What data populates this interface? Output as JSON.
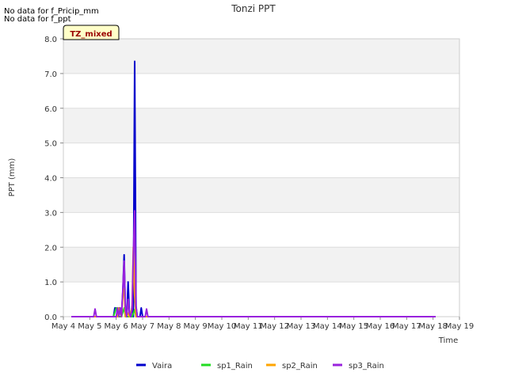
{
  "notices": [
    "No data for f_Pricip_mm",
    "No data for f_ppt"
  ],
  "chart_data": {
    "type": "line",
    "title": "Tonzi PPT",
    "xlabel": "Time",
    "ylabel": "PPT (mm)",
    "badge": "TZ_mixed",
    "ylim": [
      0,
      8
    ],
    "xlim": [
      4,
      19
    ],
    "y_ticks": [
      "0.0",
      "1.0",
      "2.0",
      "3.0",
      "4.0",
      "5.0",
      "6.0",
      "7.0",
      "8.0"
    ],
    "x_ticks": [
      "May 4",
      "May 5",
      "May 6",
      "May 7",
      "May 8",
      "May 9",
      "May 10",
      "May 11",
      "May 12",
      "May 13",
      "May 14",
      "May 15",
      "May 16",
      "May 17",
      "May 18",
      "May 19"
    ],
    "grid": true,
    "legend_position": "bottom",
    "series": [
      {
        "name": "Vaira",
        "color": "#0000cc",
        "x": [
          4.3,
          5.9,
          5.95,
          6.0,
          6.05,
          6.1,
          6.15,
          6.2,
          6.25,
          6.3,
          6.35,
          6.4,
          6.45,
          6.5,
          6.55,
          6.6,
          6.65,
          6.7,
          6.75,
          6.8,
          6.85,
          6.9,
          6.95,
          7.0,
          7.05,
          7.1,
          7.15,
          7.2,
          7.25,
          7.3,
          7.35,
          18.1
        ],
        "y": [
          0,
          0,
          0.25,
          0.25,
          0.2,
          0.25,
          0.25,
          0,
          0.7,
          1.78,
          0.1,
          0,
          1.0,
          0.1,
          0,
          0.3,
          0,
          7.35,
          0.3,
          0,
          0,
          0,
          0.25,
          0,
          0,
          0,
          0,
          0,
          0,
          0,
          0,
          0
        ]
      },
      {
        "name": "sp1_Rain",
        "color": "#22dd22",
        "x": [
          4.3,
          5.9,
          6.0,
          6.05,
          6.1,
          6.2,
          6.3,
          6.35,
          6.45,
          6.6,
          6.7,
          6.75,
          6.8,
          18.1
        ],
        "y": [
          0,
          0,
          0.25,
          0.25,
          0,
          0,
          0.25,
          0,
          0,
          0,
          0.2,
          0,
          0,
          0
        ]
      },
      {
        "name": "sp2_Rain",
        "color": "#ffa500",
        "x": [
          4.3,
          6.05,
          6.1,
          6.2,
          6.25,
          6.3,
          6.35,
          6.45,
          6.5,
          6.6,
          6.65,
          6.7,
          6.75,
          6.8,
          18.1
        ],
        "y": [
          0,
          0,
          0.25,
          0,
          0.6,
          0.8,
          0,
          0.1,
          0,
          0.25,
          2.0,
          0.6,
          0,
          0,
          0
        ]
      },
      {
        "name": "sp3_Rain",
        "color": "#9922dd",
        "x": [
          4.3,
          5.15,
          5.2,
          5.25,
          6.0,
          6.05,
          6.1,
          6.15,
          6.2,
          6.25,
          6.3,
          6.35,
          6.4,
          6.45,
          6.5,
          6.55,
          6.6,
          6.65,
          6.7,
          6.75,
          6.8,
          6.85,
          6.9,
          7.1,
          7.15,
          7.2,
          18.1
        ],
        "y": [
          0,
          0,
          0.22,
          0,
          0,
          0.25,
          0,
          0.25,
          0,
          0.75,
          1.6,
          0.2,
          0,
          0.5,
          0.1,
          0,
          0.2,
          1.78,
          3.05,
          0.3,
          0,
          0,
          0,
          0,
          0.22,
          0,
          0
        ]
      }
    ]
  }
}
